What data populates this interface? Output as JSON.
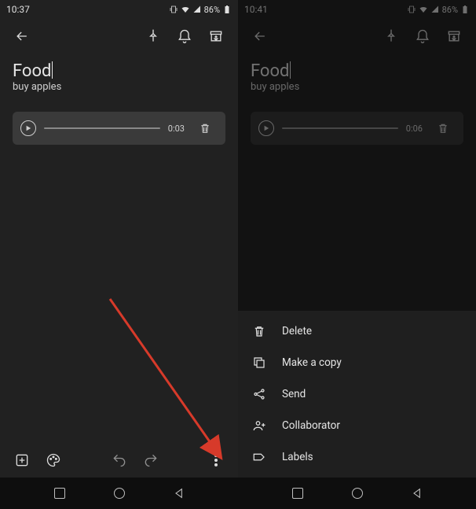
{
  "left": {
    "status": {
      "time": "10:37",
      "battery": "86%"
    },
    "note": {
      "title": "Food",
      "body": "buy apples",
      "duration": "0:03"
    }
  },
  "right": {
    "status": {
      "time": "10:41",
      "battery": "86%"
    },
    "note": {
      "title": "Food",
      "body": "buy apples",
      "duration": "0:06"
    },
    "menu": {
      "delete": "Delete",
      "copy": "Make a copy",
      "send": "Send",
      "collaborator": "Collaborator",
      "labels": "Labels"
    }
  }
}
